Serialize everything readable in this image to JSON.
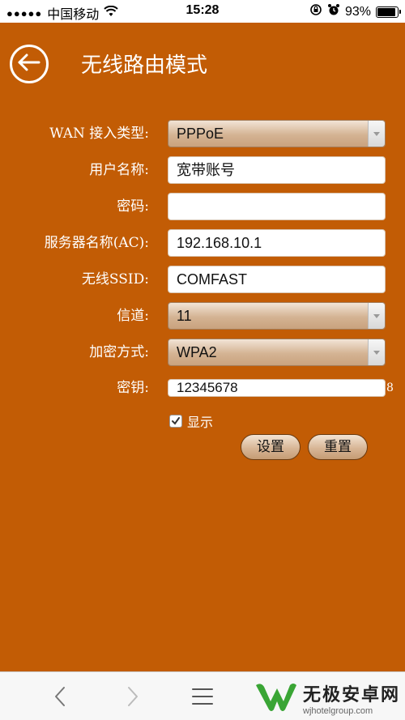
{
  "status_bar": {
    "signal": "●●●●●",
    "carrier": "中国移动",
    "time": "15:28",
    "battery_percent": "93%",
    "battery_level": 0.93
  },
  "header": {
    "title": "无线路由模式"
  },
  "form": {
    "wan_type": {
      "label": "WAN 接入类型:",
      "value": "PPPoE"
    },
    "username": {
      "label": "用户名称:",
      "value": "宽带账号"
    },
    "password": {
      "label": "密码:",
      "value": ""
    },
    "server_name": {
      "label": "服务器名称(AC):",
      "value": "192.168.10.1"
    },
    "ssid": {
      "label": "无线SSID:",
      "value": "COMFAST"
    },
    "channel": {
      "label": "信道:",
      "value": "11"
    },
    "encryption": {
      "label": "加密方式:",
      "value": "WPA2"
    },
    "key": {
      "label": "密钥:",
      "value": "12345678",
      "suffix": "8"
    },
    "show": {
      "label": "显示",
      "checked": true
    }
  },
  "buttons": {
    "set": "设置",
    "reset": "重置"
  },
  "watermark": {
    "name": "无极安卓网",
    "url": "wjhotelgroup.com"
  },
  "colors": {
    "background": "#c25c05",
    "watermark_green": "#3aa535"
  }
}
